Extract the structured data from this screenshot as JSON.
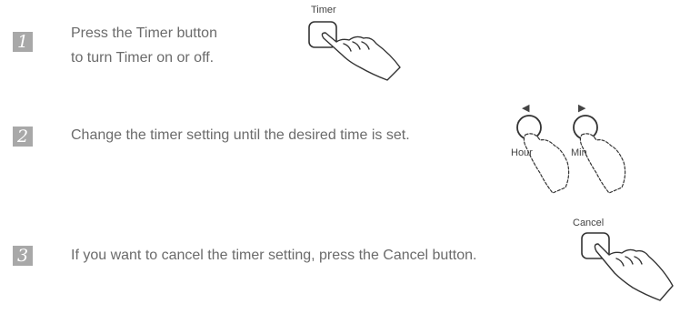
{
  "steps": [
    {
      "number": "1",
      "lines": [
        "Press the Timer button",
        "to turn Timer on or off."
      ],
      "illustration": {
        "button_label": "Timer",
        "icon": "hand-pressing-button-icon"
      }
    },
    {
      "number": "2",
      "lines": [
        "Change the timer setting until the desired time is set."
      ],
      "illustration": {
        "left_label": "Hour",
        "right_label": "Min",
        "left_arrow": "◀",
        "right_arrow": "▶",
        "icon": "hand-pressing-button-icon"
      }
    },
    {
      "number": "3",
      "lines": [
        "If you want to cancel the timer setting, press the Cancel button."
      ],
      "illustration": {
        "button_label": "Cancel",
        "icon": "hand-pressing-button-icon"
      }
    }
  ],
  "colors": {
    "text": "#6b6b6b",
    "number_box": "#a8a8a8",
    "line_art": "#333333"
  }
}
